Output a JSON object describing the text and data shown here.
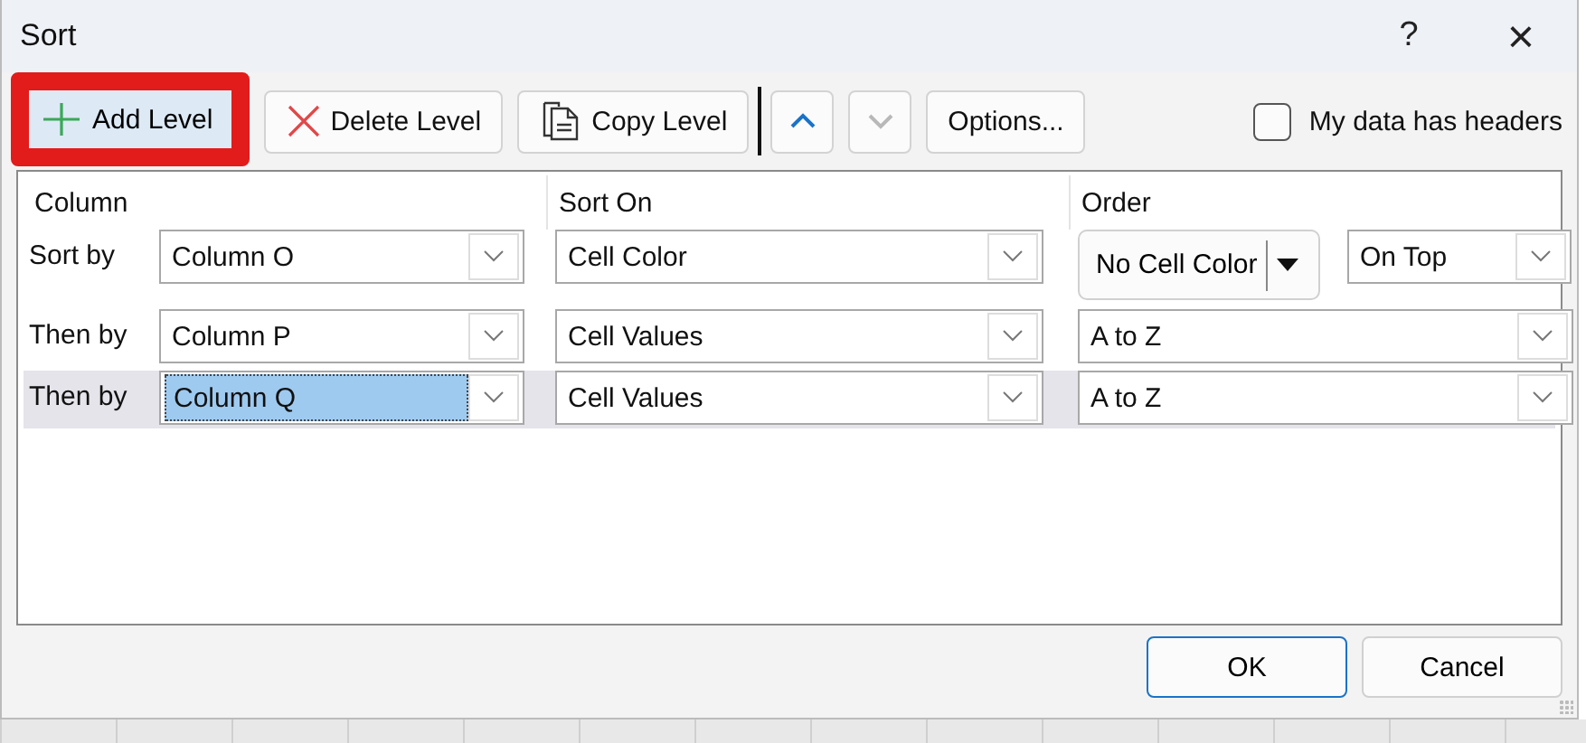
{
  "window": {
    "title": "Sort",
    "help": "?",
    "close": "×"
  },
  "toolbar": {
    "buttons": [
      {
        "kind": "add",
        "label": "Add Level",
        "highlighted": true
      },
      {
        "kind": "delete",
        "label": "Delete Level",
        "highlighted": false
      },
      {
        "kind": "copy",
        "label": "Copy Level",
        "highlighted": false
      },
      {
        "kind": "up",
        "disabled": false
      },
      {
        "kind": "down",
        "disabled": true
      },
      {
        "kind": "text",
        "label": "Options...",
        "highlighted": false
      }
    ],
    "headers_checkbox": {
      "label": "My data has headers",
      "checked": false
    }
  },
  "table": {
    "columns": [
      "Column",
      "Sort On",
      "Order"
    ],
    "rows": [
      {
        "label": "Sort by",
        "column": "Column O",
        "sort_on": "Cell Color",
        "order": {
          "kind": "color",
          "color_label": "No Cell Color",
          "position": "On Top"
        },
        "selected": false
      },
      {
        "label": "Then by",
        "column": "Column P",
        "sort_on": "Cell Values",
        "order": {
          "kind": "value",
          "value": "A to Z"
        },
        "selected": false
      },
      {
        "label": "Then by",
        "column": "Column Q",
        "sort_on": "Cell Values",
        "order": {
          "kind": "value",
          "value": "A to Z"
        },
        "selected": true
      }
    ]
  },
  "footer": {
    "buttons": [
      {
        "label": "OK",
        "default": true
      },
      {
        "label": "Cancel",
        "default": false
      }
    ]
  }
}
